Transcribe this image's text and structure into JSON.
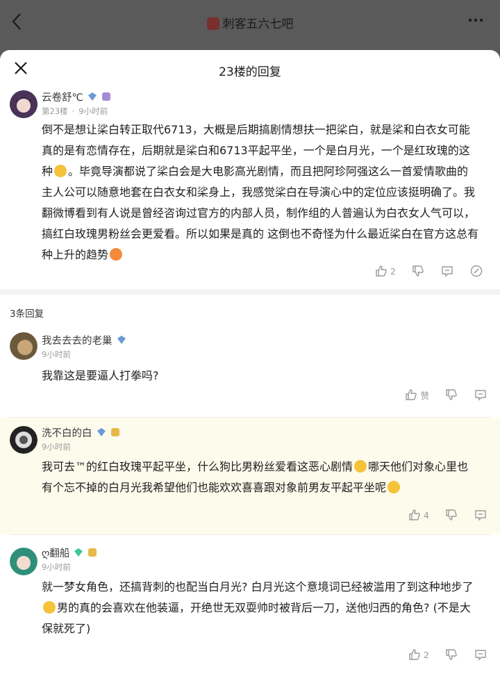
{
  "header": {
    "forum_name": "刺客五六七吧",
    "back_icon": "chevron-left-icon",
    "more_icon": "more-horizontal-icon"
  },
  "sheet": {
    "title": "23楼的回复"
  },
  "main_post": {
    "user": "云卷舒℃",
    "floor": "第23楼",
    "time": "9小时前",
    "text_1": "倒不是想让桬白转正取代6713，大概是后期搞剧情想扶一把桬白，就是桬和白衣女可能真的是有恋情存在，后期就是桬白和6713平起平坐，一个是白月光，一个是红玫瑰的这种",
    "text_2": "。毕竟导演都说了桬白会是大电影高光剧情，而且把阿珍阿强这么一首爱情歌曲的主人公可以随意地套在白衣女和桬身上，我感觉桬白在导演心中的定位应该挺明确了。我翻微博看到有人说是曾经咨询过官方的内部人员，制作组的人普遍认为白衣女人气可以，搞红白玫瑰男粉丝会更爱看。所以如果是真的 这倒也不奇怪为什么最近桬白在官方这总有种上升的趋势",
    "likes": "2"
  },
  "reply_count": "3条回复",
  "replies": [
    {
      "user": "我去去去的老巢",
      "time": "9小时前",
      "text": "我靠这是要逼人打拳吗?",
      "likes": "赞"
    },
    {
      "user": "洗不白的白",
      "time": "9小时前",
      "text_1": "我可去™的红白玫瑰平起平坐，什么狗比男粉丝爱看这恶心剧情",
      "text_2": "哪天他们对象心里也有个忘不掉的白月光我希望他们也能欢欢喜喜跟对象前男友平起平坐呢",
      "likes": "4"
    },
    {
      "user": "ღ翻船",
      "time": "9小时前",
      "text_1": "就一梦女角色，还搞背刺的也配当白月光? 白月光这个意境词已经被滥用了到这种地步了",
      "text_2": "男的真的会喜欢在他装逼，开绝世无双耍帅时被背后一刀，送他归西的角色? (不是大保就死了)",
      "likes": "2"
    }
  ],
  "colors": {
    "highlight_bg": "#fdfbec",
    "page_dim": "#5a5a5a",
    "verified_blue": "#6a9bd8",
    "verified_green": "#3cc7a0"
  }
}
